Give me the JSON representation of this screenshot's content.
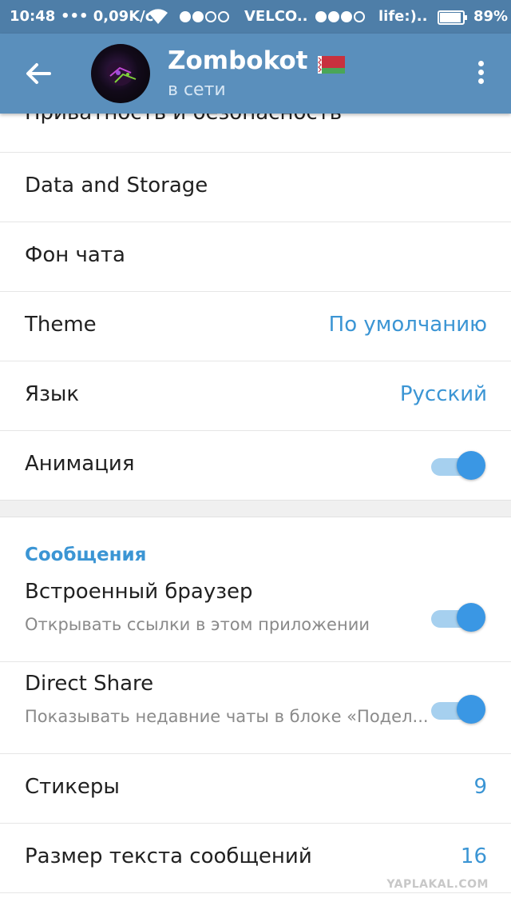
{
  "status_bar": {
    "time": "10:48",
    "speed": "••• 0,09K/c",
    "carrier1": "VELCO..",
    "carrier2": "life:)..",
    "battery": "89%"
  },
  "header": {
    "title": "Zombokot",
    "subtitle": "в сети"
  },
  "settings": {
    "privacy": "Приватность и безопасность",
    "data_storage": "Data and Storage",
    "chat_background": "Фон чата",
    "theme_label": "Theme",
    "theme_value": "По умолчанию",
    "language_label": "Язык",
    "language_value": "Русский",
    "animation_label": "Анимация",
    "animation_enabled": true
  },
  "messages": {
    "section_title": "Сообщения",
    "browser_label": "Встроенный браузер",
    "browser_sub": "Открывать ссылки в этом приложении",
    "browser_enabled": true,
    "direct_share_label": "Direct Share",
    "direct_share_sub": "Показывать недавние чаты в блоке «Подел...",
    "direct_share_enabled": true,
    "stickers_label": "Стикеры",
    "stickers_value": "9",
    "text_size_label": "Размер текста сообщений",
    "text_size_value": "16"
  },
  "watermark": "YAPLAKAL.COM",
  "colors": {
    "status_bar": "#4e7ea8",
    "app_bar": "#5a8fbc",
    "accent": "#3b95d4",
    "toggle_on": "#3a97e4"
  }
}
